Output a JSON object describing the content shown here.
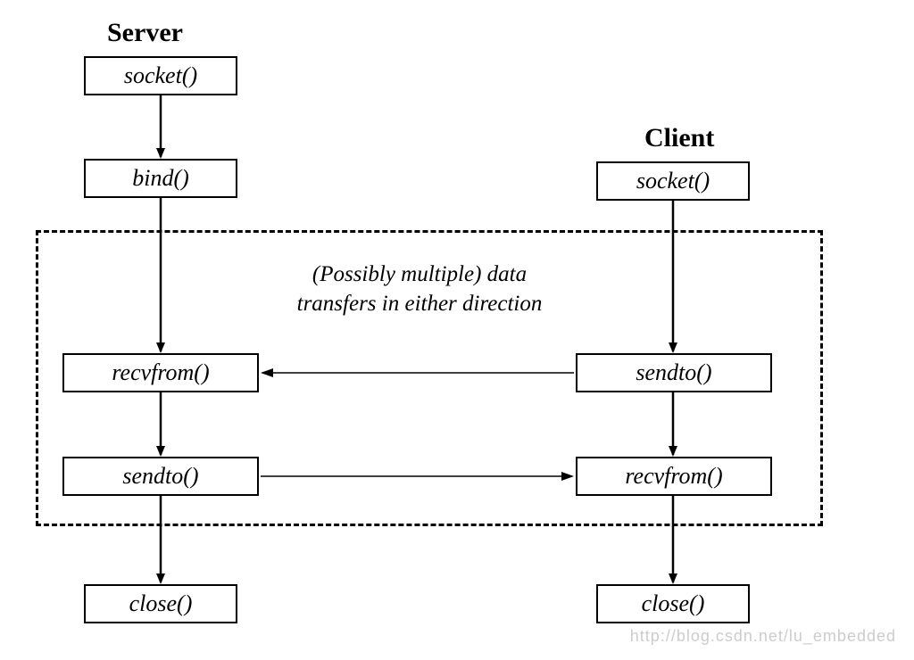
{
  "server": {
    "title": "Server",
    "boxes": [
      "socket()",
      "bind()",
      "recvfrom()",
      "sendto()",
      "close()"
    ]
  },
  "client": {
    "title": "Client",
    "boxes": [
      "socket()",
      "sendto()",
      "recvfrom()",
      "close()"
    ]
  },
  "region_label_line1": "(Possibly multiple) data",
  "region_label_line2": "transfers in either direction",
  "watermark": "http://blog.csdn.net/lu_embedded"
}
